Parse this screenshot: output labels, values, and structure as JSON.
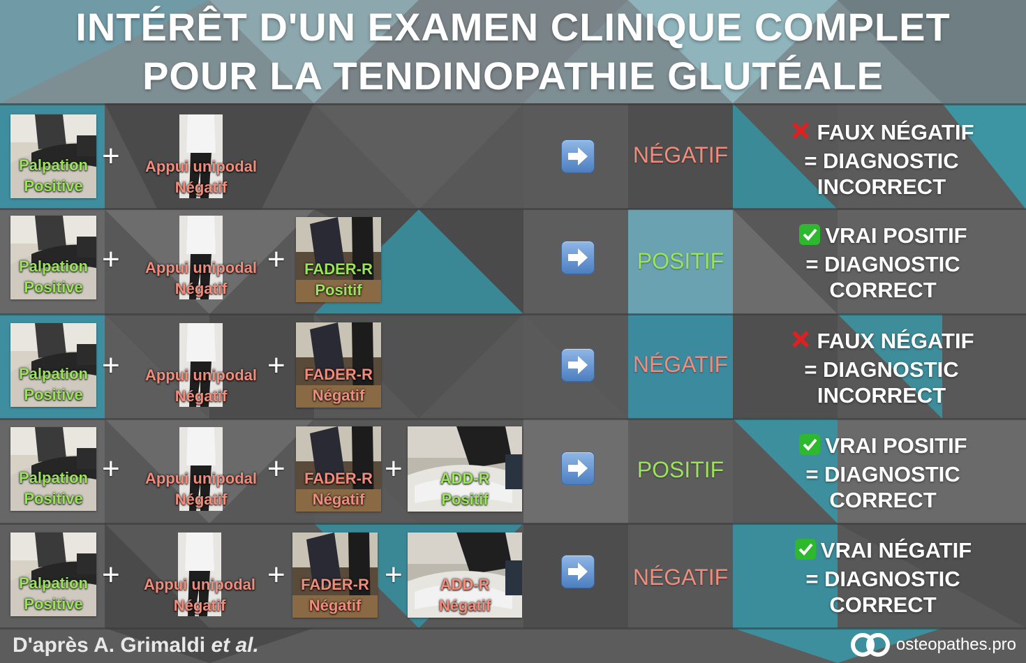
{
  "header": {
    "title_line1": "INTÉRÊT D'UN EXAMEN CLINIQUE COMPLET",
    "title_line2": "POUR LA TENDINOPATHIE GLUTÉALE"
  },
  "tests": {
    "palpation": {
      "name": "Palpation",
      "outcome": "Positive"
    },
    "appui": {
      "name": "Appui unipodal",
      "outcome": "Négatif"
    },
    "fader_pos": {
      "name": "FADER-R",
      "outcome": "Positif"
    },
    "fader_neg": {
      "name": "FADER-R",
      "outcome": "Négatif"
    },
    "add_pos": {
      "name": "ADD-R",
      "outcome": "Positif"
    },
    "add_neg": {
      "name": "ADD-R",
      "outcome": "Négatif"
    }
  },
  "plus_sign": "+",
  "rows": [
    {
      "result": "NÉGATIF",
      "verdict_line1": "FAUX NÉGATIF",
      "verdict_line2": "= DIAGNOSTIC",
      "verdict_line3": "INCORRECT"
    },
    {
      "result": "POSITIF",
      "verdict_line1": "VRAI POSITIF",
      "verdict_line2": "= DIAGNOSTIC",
      "verdict_line3": "CORRECT"
    },
    {
      "result": "NÉGATIF",
      "verdict_line1": "FAUX NÉGATIF",
      "verdict_line2": "= DIAGNOSTIC",
      "verdict_line3": "INCORRECT"
    },
    {
      "result": "POSITIF",
      "verdict_line1": "VRAI POSITIF",
      "verdict_line2": "= DIAGNOSTIC",
      "verdict_line3": "CORRECT"
    },
    {
      "result": "NÉGATIF",
      "verdict_line1": "VRAI NÉGATIF",
      "verdict_line2": "= DIAGNOSTIC",
      "verdict_line3": "CORRECT"
    }
  ],
  "footer": {
    "credit": "D'après A. Grimaldi",
    "credit_italic": "et al.",
    "brand": "osteopathes.pro"
  },
  "colors": {
    "positive": "#9be35a",
    "negative": "#f08c7c",
    "check_green": "#2eb82e",
    "cross_red": "#e02020",
    "arrow_blue": "#5b8ed0"
  },
  "icons": [
    "cross-icon",
    "checkmark-icon",
    "right-arrow-icon",
    "brand-logo-icon"
  ]
}
